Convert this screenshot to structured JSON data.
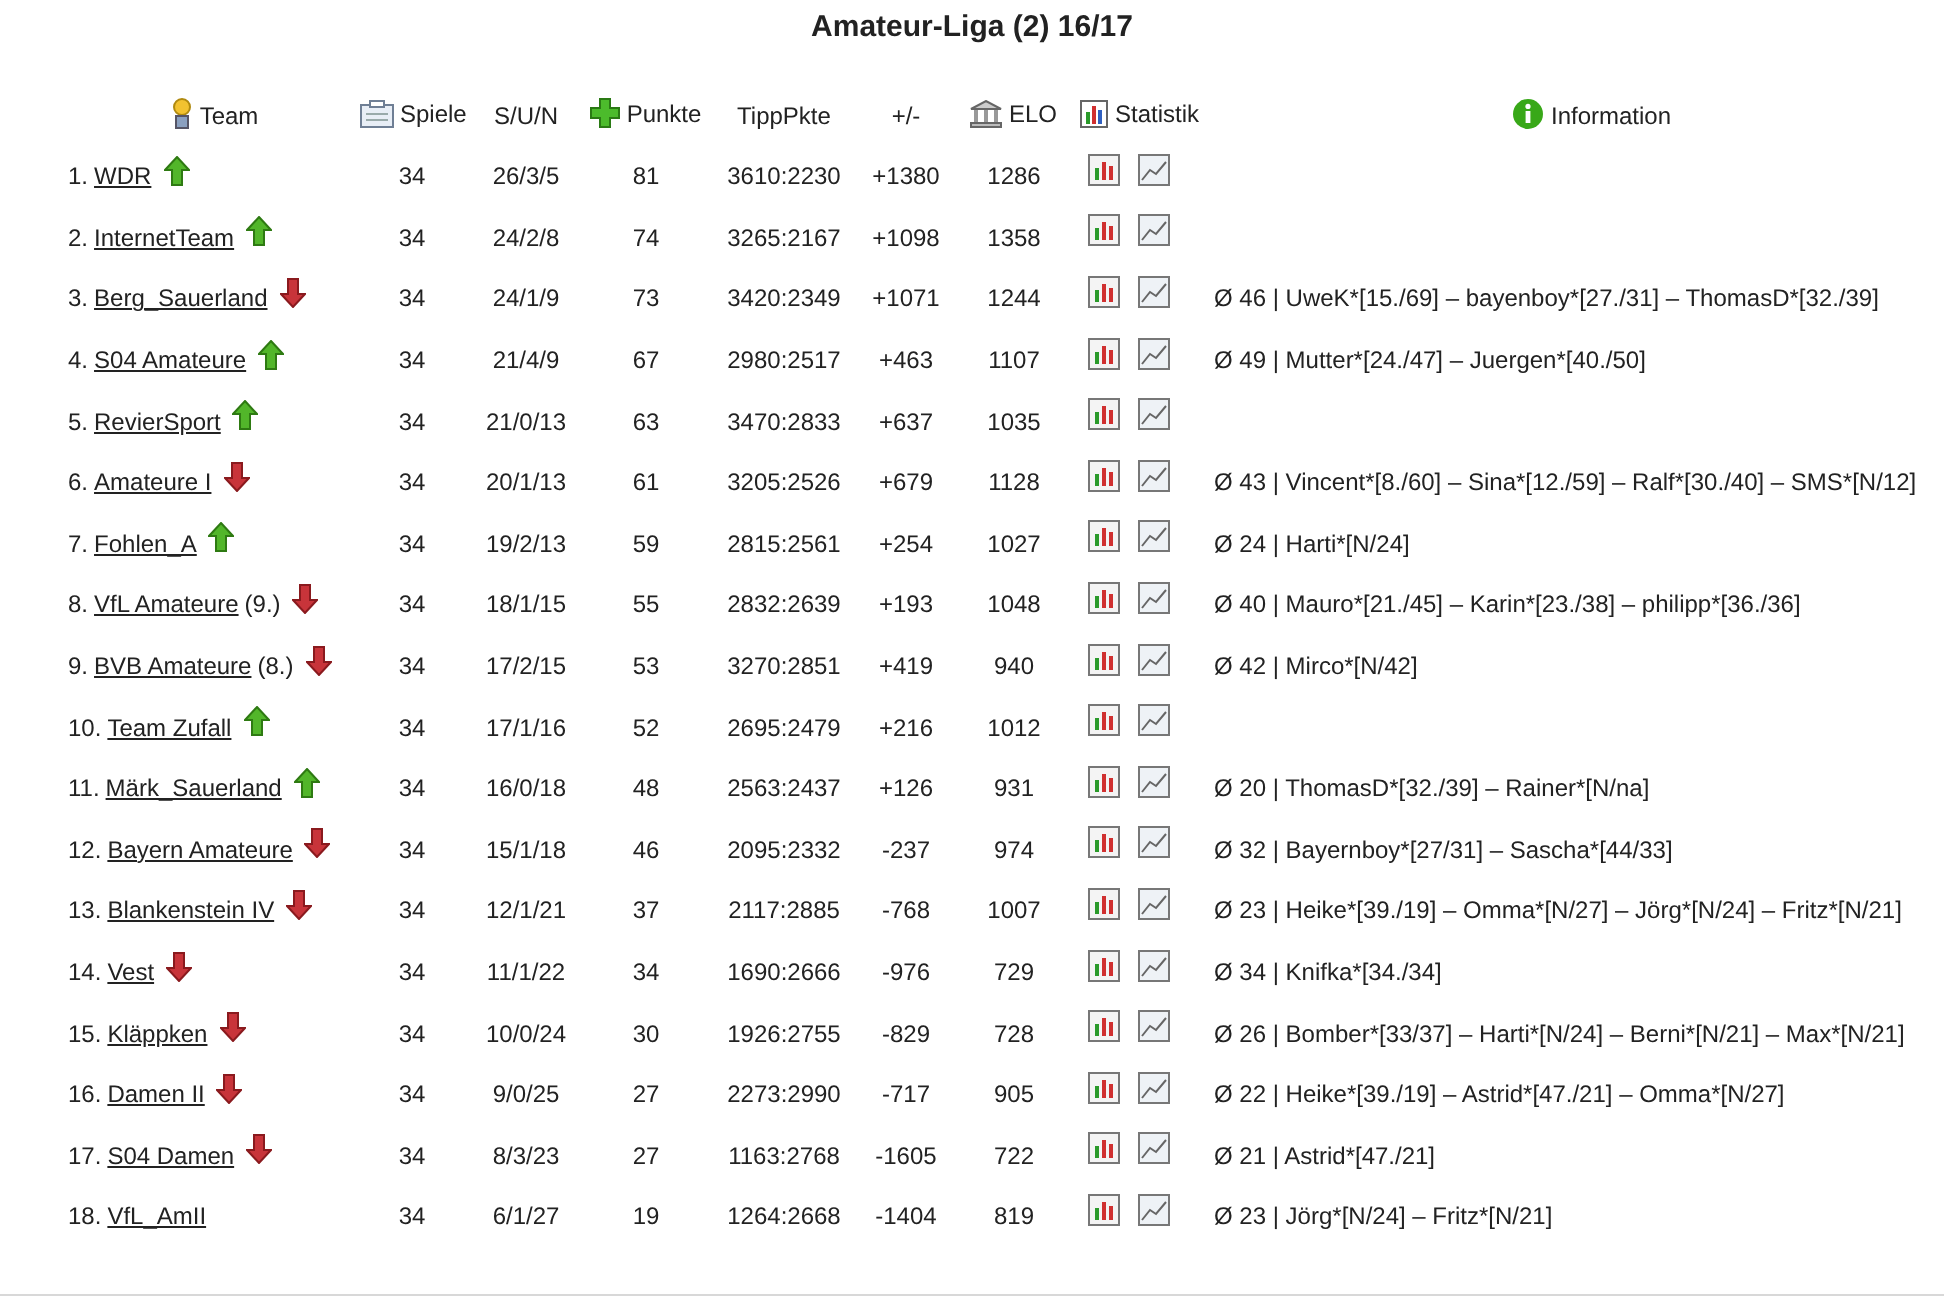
{
  "title": "Amateur-Liga (2) 16/17",
  "columns": [
    "Team",
    "Spiele",
    "S/U/N",
    "Punkte",
    "TippPkte",
    "+/-",
    "ELO",
    "Statistik",
    "Information"
  ],
  "rows": [
    {
      "rank": "1.",
      "team": "WDR",
      "kind": "up",
      "games": "34",
      "sun": "26/3/5",
      "points": "81",
      "tipp": "3610:2230",
      "diff": "+1380",
      "elo": "1286"
    },
    {
      "rank": "2.",
      "team": "InternetTeam",
      "kind": "up",
      "games": "34",
      "sun": "24/2/8",
      "points": "74",
      "tipp": "3265:2167",
      "diff": "+1098",
      "elo": "1358"
    },
    {
      "rank": "3.",
      "team": "Berg_Sauerland",
      "kind": "down",
      "games": "34",
      "sun": "24/1/9",
      "points": "73",
      "tipp": "3420:2349",
      "diff": "+1071",
      "elo": "1244",
      "info": "Ø 46 | UweK*[15./69] – bayenboy*[27./31] – ThomasD*[32./39]"
    },
    {
      "rank": "4.",
      "team": "S04 Amateure",
      "kind": "up",
      "games": "34",
      "sun": "21/4/9",
      "points": "67",
      "tipp": "2980:2517",
      "diff": "+463",
      "elo": "1107",
      "info": "Ø 49 | Mutter*[24./47] – Juergen*[40./50]"
    },
    {
      "rank": "5.",
      "team": "RevierSport",
      "kind": "up",
      "games": "34",
      "sun": "21/0/13",
      "points": "63",
      "tipp": "3470:2833",
      "diff": "+637",
      "elo": "1035"
    },
    {
      "rank": "6.",
      "team": "Amateure I",
      "kind": "down",
      "games": "34",
      "sun": "20/1/13",
      "points": "61",
      "tipp": "3205:2526",
      "diff": "+679",
      "elo": "1128",
      "info": "Ø 43 | Vincent*[8./60] – Sina*[12./59] – Ralf*[30./40] – SMS*[N/12]"
    },
    {
      "rank": "7.",
      "team": "Fohlen_A",
      "kind": "up",
      "games": "34",
      "sun": "19/2/13",
      "points": "59",
      "tipp": "2815:2561",
      "diff": "+254",
      "elo": "1027",
      "info": "Ø 24 | Harti*[N/24]"
    },
    {
      "rank": "8.",
      "team": "VfL Amateure",
      "note": "(9.)",
      "kind": "down",
      "games": "34",
      "sun": "18/1/15",
      "points": "55",
      "tipp": "2832:2639",
      "diff": "+193",
      "elo": "1048",
      "info": "Ø 40 | Mauro*[21./45] – Karin*[23./38] – philipp*[36./36]"
    },
    {
      "rank": "9.",
      "team": "BVB Amateure",
      "note": "(8.)",
      "kind": "down",
      "games": "34",
      "sun": "17/2/15",
      "points": "53",
      "tipp": "3270:2851",
      "diff": "+419",
      "elo": "940",
      "info": "Ø 42 | Mirco*[N/42]"
    },
    {
      "rank": "10.",
      "team": "Team Zufall",
      "kind": "up",
      "games": "34",
      "sun": "17/1/16",
      "points": "52",
      "tipp": "2695:2479",
      "diff": "+216",
      "elo": "1012"
    },
    {
      "rank": "11.",
      "team": "Märk_Sauerland",
      "kind": "up",
      "games": "34",
      "sun": "16/0/18",
      "points": "48",
      "tipp": "2563:2437",
      "diff": "+126",
      "elo": "931",
      "info": "Ø 20 | ThomasD*[32./39] – Rainer*[N/na]"
    },
    {
      "rank": "12.",
      "team": "Bayern Amateure",
      "kind": "down",
      "games": "34",
      "sun": "15/1/18",
      "points": "46",
      "tipp": "2095:2332",
      "diff": "-237",
      "elo": "974",
      "info": "Ø 32 | Bayernboy*[27/31] – Sascha*[44/33]"
    },
    {
      "rank": "13.",
      "team": "Blankenstein IV",
      "kind": "down",
      "games": "34",
      "sun": "12/1/21",
      "points": "37",
      "tipp": "2117:2885",
      "diff": "-768",
      "elo": "1007",
      "info": "Ø 23 | Heike*[39./19] – Omma*[N/27] – Jörg*[N/24] – Fritz*[N/21]"
    },
    {
      "rank": "14.",
      "team": "Vest",
      "kind": "down",
      "games": "34",
      "sun": "11/1/22",
      "points": "34",
      "tipp": "1690:2666",
      "diff": "-976",
      "elo": "729",
      "info": "Ø 34 | Knifka*[34./34]"
    },
    {
      "rank": "15.",
      "team": "Kläppken",
      "kind": "down",
      "games": "34",
      "sun": "10/0/24",
      "points": "30",
      "tipp": "1926:2755",
      "diff": "-829",
      "elo": "728",
      "info": "Ø 26 | Bomber*[33/37] – Harti*[N/24] – Berni*[N/21] – Max*[N/21]"
    },
    {
      "rank": "16.",
      "team": "Damen II",
      "kind": "down",
      "games": "34",
      "sun": "9/0/25",
      "points": "27",
      "tipp": "2273:2990",
      "diff": "-717",
      "elo": "905",
      "info": "Ø 22 | Heike*[39./19] – Astrid*[47./21] – Omma*[N/27]"
    },
    {
      "rank": "17.",
      "team": "S04 Damen",
      "kind": "down",
      "games": "34",
      "sun": "8/3/23",
      "points": "27",
      "tipp": "1163:2768",
      "diff": "-1605",
      "elo": "722",
      "info": "Ø 21 | Astrid*[47./21]"
    },
    {
      "rank": "18.",
      "team": "VfL_AmII",
      "kind": "plain",
      "games": "34",
      "sun": "6/1/27",
      "points": "19",
      "tipp": "1264:2668",
      "diff": "-1404",
      "elo": "819",
      "info": "Ø 23 | Jörg*[N/24] – Fritz*[N/21]"
    }
  ]
}
